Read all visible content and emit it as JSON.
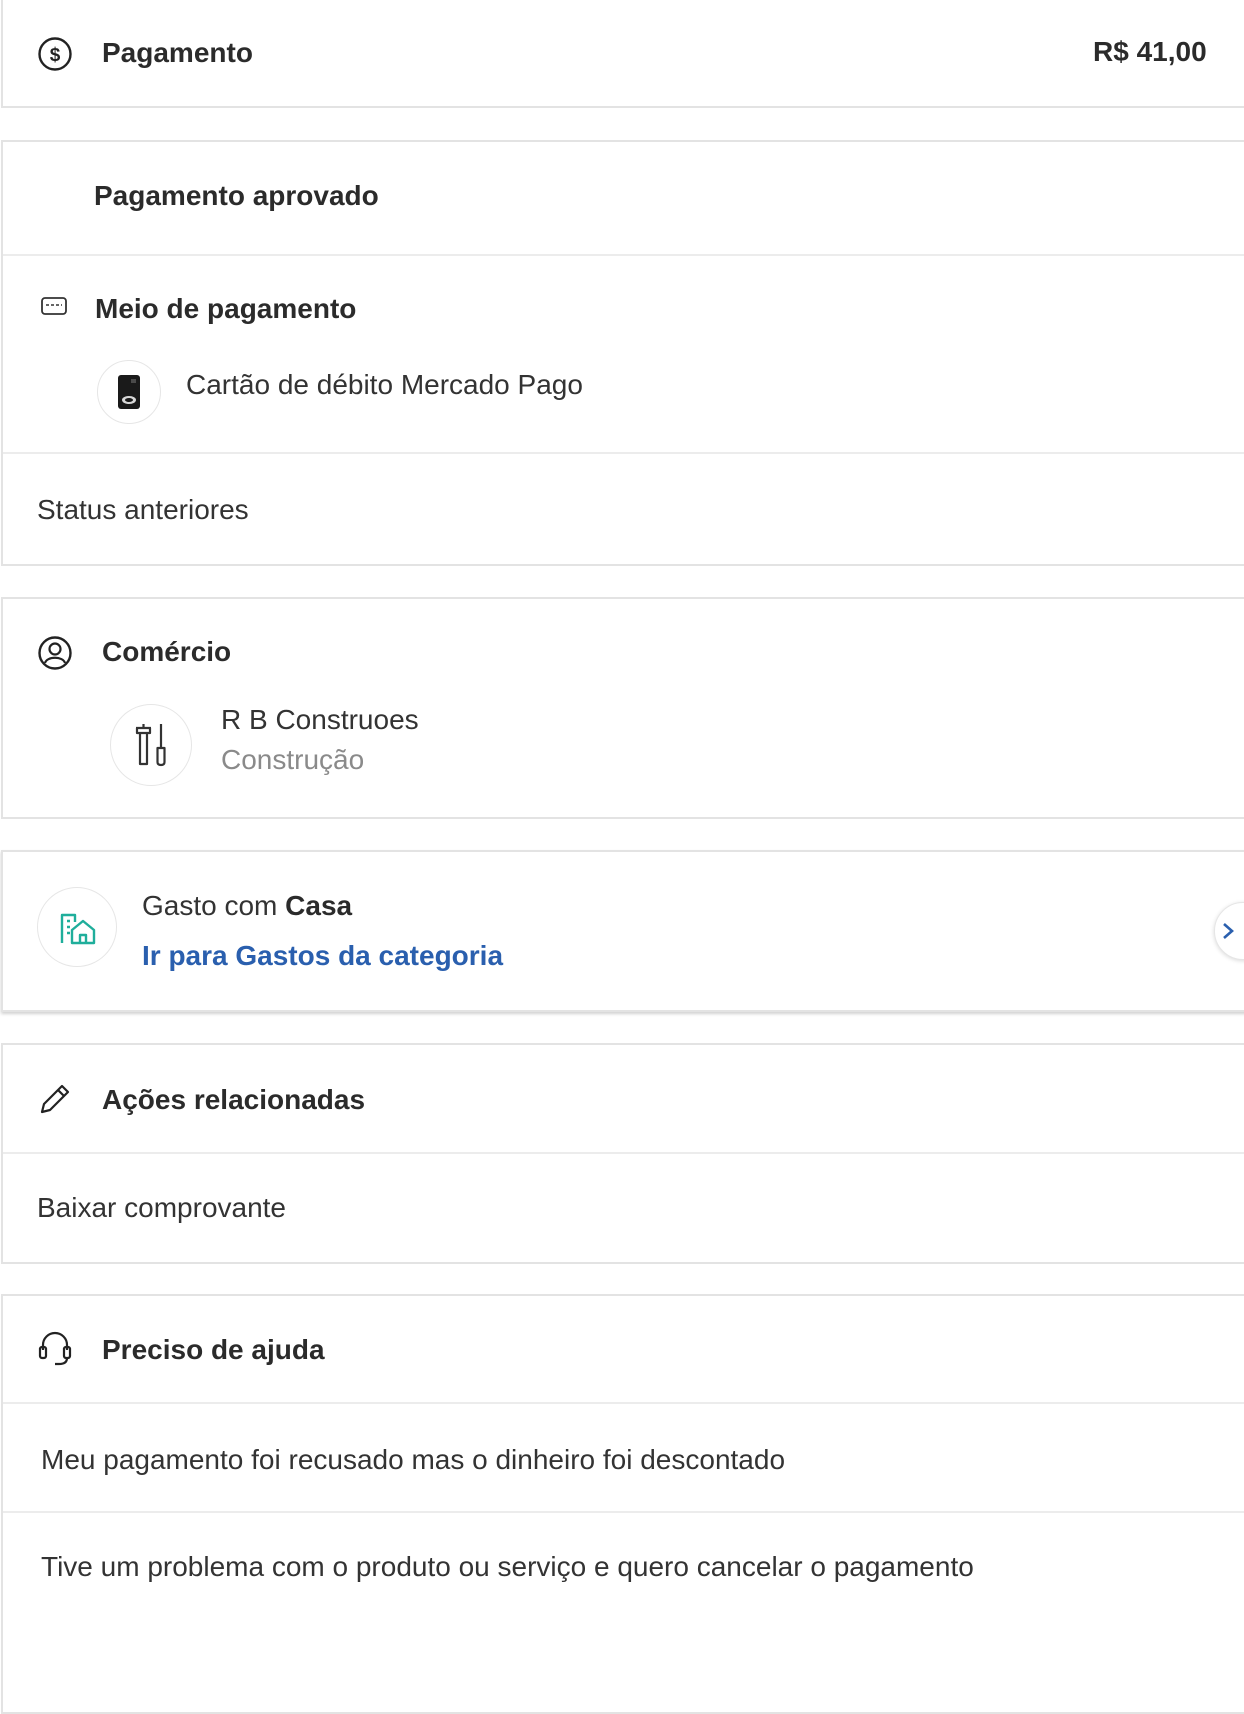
{
  "header": {
    "title": "Pagamento",
    "amount": "R$ 41,00"
  },
  "payment": {
    "status": "Pagamento aprovado",
    "method_title": "Meio de pagamento",
    "method_name": "Cartão de débito Mercado Pago",
    "previous_status": "Status anteriores"
  },
  "merchant": {
    "section_title": "Comércio",
    "name": "R B Construoes",
    "category": "Construção"
  },
  "spending": {
    "prefix": "Gasto com ",
    "category": "Casa",
    "link": "Ir para Gastos da categoria"
  },
  "actions": {
    "section_title": "Ações relacionadas",
    "download": "Baixar comprovante"
  },
  "help": {
    "section_title": "Preciso de ajuda",
    "items": [
      "Meu pagamento foi recusado mas o dinheiro foi descontado",
      "Tive um problema com o produto ou serviço e quero cancelar o pagamento"
    ]
  },
  "colors": {
    "link": "#2a5fae",
    "accent_teal": "#1fae9b",
    "border": "#e3e3e3"
  }
}
